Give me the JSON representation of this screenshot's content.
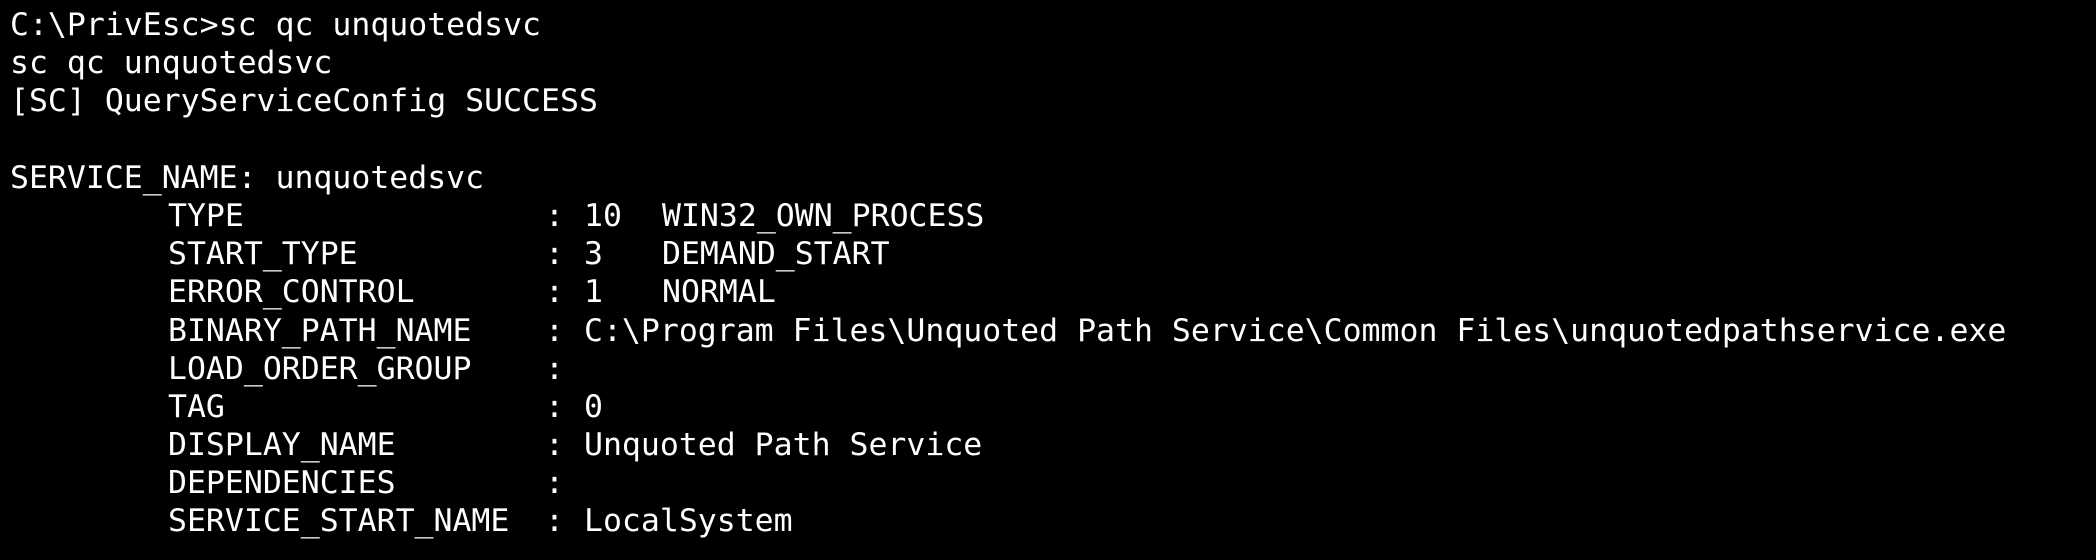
{
  "terminal": {
    "prompt_line": "C:\\PrivEsc>sc qc unquotedsvc",
    "echo_line": "sc qc unquotedsvc",
    "status_line": "[SC] QueryServiceConfig SUCCESS",
    "service_name_line": "SERVICE_NAME: unquotedsvc",
    "colors": {
      "background": "#000000",
      "text": "#ffffff"
    },
    "fields": [
      {
        "key": "TYPE",
        "sep": ":",
        "code": "10",
        "value": "WIN32_OWN_PROCESS"
      },
      {
        "key": "START_TYPE",
        "sep": ":",
        "code": "3",
        "value": "DEMAND_START"
      },
      {
        "key": "ERROR_CONTROL",
        "sep": ":",
        "code": "1",
        "value": "NORMAL"
      },
      {
        "key": "BINARY_PATH_NAME",
        "sep": ":",
        "code": "",
        "value": "C:\\Program Files\\Unquoted Path Service\\Common Files\\unquotedpathservice.exe"
      },
      {
        "key": "LOAD_ORDER_GROUP",
        "sep": ":",
        "code": "",
        "value": ""
      },
      {
        "key": "TAG",
        "sep": ":",
        "code": "",
        "value": "0"
      },
      {
        "key": "DISPLAY_NAME",
        "sep": ":",
        "code": "",
        "value": "Unquoted Path Service"
      },
      {
        "key": "DEPENDENCIES",
        "sep": ":",
        "code": "",
        "value": ""
      },
      {
        "key": "SERVICE_START_NAME",
        "sep": ":",
        "code": "",
        "value": "LocalSystem"
      }
    ]
  }
}
